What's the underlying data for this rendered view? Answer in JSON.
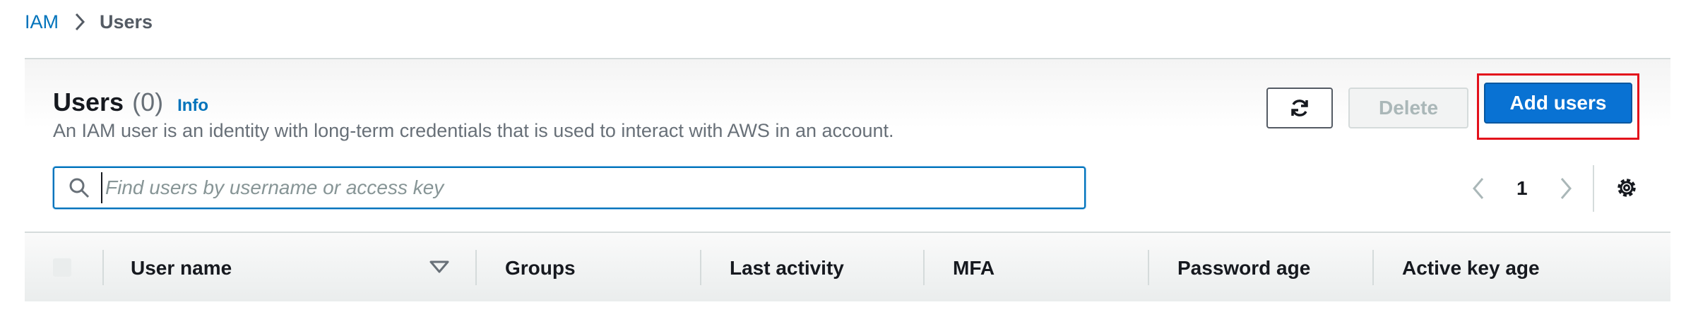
{
  "breadcrumb": {
    "root": "IAM",
    "current": "Users"
  },
  "header": {
    "title": "Users",
    "count": "(0)",
    "info": "Info",
    "description": "An IAM user is an identity with long-term credentials that is used to interact with AWS in an account."
  },
  "actions": {
    "refresh_icon": "refresh-icon",
    "delete_label": "Delete",
    "add_label": "Add users"
  },
  "search": {
    "placeholder": "Find users by username or access key",
    "value": ""
  },
  "pagination": {
    "current_page": "1"
  },
  "table": {
    "columns": [
      "User name",
      "Groups",
      "Last activity",
      "MFA",
      "Password age",
      "Active key age"
    ]
  },
  "colors": {
    "primary": "#0972d3",
    "link": "#0073bb",
    "highlight": "#e3101b"
  }
}
